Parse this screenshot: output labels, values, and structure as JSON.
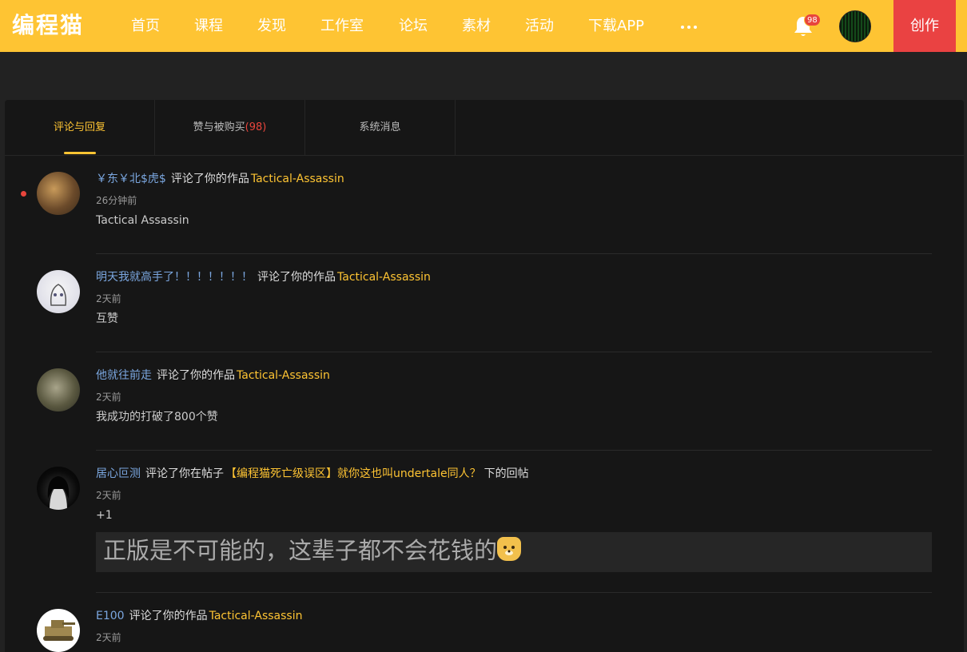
{
  "header": {
    "logo": "编程猫",
    "nav": [
      "首页",
      "课程",
      "发现",
      "工作室",
      "论坛",
      "素材",
      "活动",
      "下载APP"
    ],
    "notification_count": "98",
    "create_label": "创作",
    "brand_color": "#fec433",
    "create_color": "#ea4242"
  },
  "tabs": [
    {
      "label": "评论与回复"
    },
    {
      "label": "赞与被购买",
      "count": "(98)"
    },
    {
      "label": "系统消息"
    }
  ],
  "messages": [
    {
      "user": "￥东￥北$虎$",
      "action": "评论了你的作品",
      "target": "Tactical-Assassin",
      "time": "26分钟前",
      "text": "Tactical Assassin",
      "unread": true
    },
    {
      "user": "明天我就高手了！！！！！！！",
      "action": "评论了你的作品",
      "target": "Tactical-Assassin",
      "time": "2天前",
      "text": "互赞"
    },
    {
      "user": "他就往前走",
      "action": "评论了你的作品",
      "target": "Tactical-Assassin",
      "time": "2天前",
      "text": "我成功的打破了800个赞"
    },
    {
      "user": "居心叵测",
      "action": "评论了你在帖子",
      "target": "【编程猫死亡级误区】就你这也叫undertale同人？",
      "suffix": "下的回帖",
      "time": "2天前",
      "text": "+1",
      "quote": "正版是不可能的，这辈子都不会花钱的"
    },
    {
      "user": "E100",
      "action": "评论了你的作品",
      "target": "Tactical-Assassin",
      "time": "2天前"
    }
  ]
}
